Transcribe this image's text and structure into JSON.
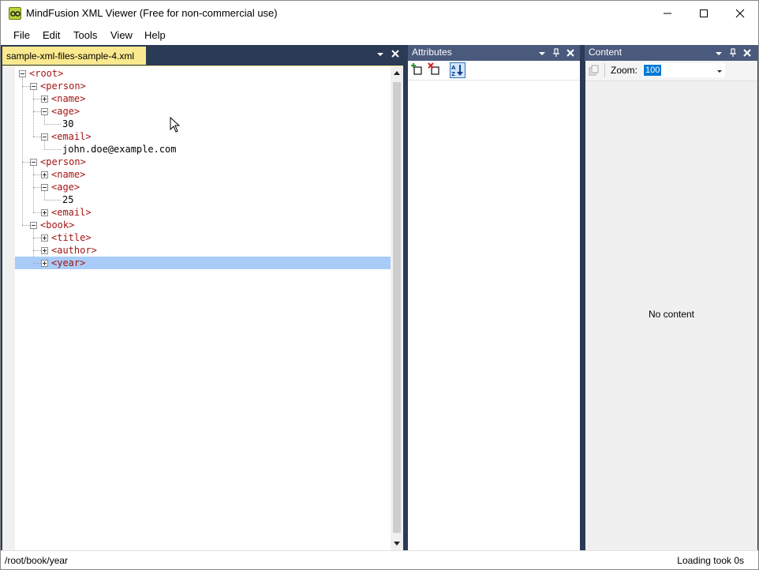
{
  "window": {
    "title": "MindFusion XML Viewer (Free for non-commercial use)"
  },
  "menu": [
    "File",
    "Edit",
    "Tools",
    "View",
    "Help"
  ],
  "document": {
    "tab_label": "sample-xml-files-sample-4.xml",
    "tree": [
      {
        "level": 0,
        "text": "<root>",
        "kind": "element",
        "expander": "minus"
      },
      {
        "level": 1,
        "text": "<person>",
        "kind": "element",
        "expander": "minus"
      },
      {
        "level": 2,
        "text": "<name>",
        "kind": "element",
        "expander": "plus"
      },
      {
        "level": 2,
        "text": "<age>",
        "kind": "element",
        "expander": "minus"
      },
      {
        "level": 3,
        "text": "30",
        "kind": "text",
        "expander": "none"
      },
      {
        "level": 2,
        "text": "<email>",
        "kind": "element",
        "expander": "minus"
      },
      {
        "level": 3,
        "text": "john.doe@example.com",
        "kind": "text",
        "expander": "none"
      },
      {
        "level": 1,
        "text": "<person>",
        "kind": "element",
        "expander": "minus"
      },
      {
        "level": 2,
        "text": "<name>",
        "kind": "element",
        "expander": "plus"
      },
      {
        "level": 2,
        "text": "<age>",
        "kind": "element",
        "expander": "minus"
      },
      {
        "level": 3,
        "text": "25",
        "kind": "text",
        "expander": "none"
      },
      {
        "level": 2,
        "text": "<email>",
        "kind": "element",
        "expander": "plus"
      },
      {
        "level": 1,
        "text": "<book>",
        "kind": "element",
        "expander": "minus"
      },
      {
        "level": 2,
        "text": "<title>",
        "kind": "element",
        "expander": "plus"
      },
      {
        "level": 2,
        "text": "<author>",
        "kind": "element",
        "expander": "plus"
      },
      {
        "level": 2,
        "text": "<year>",
        "kind": "element",
        "expander": "plus",
        "selected": true
      }
    ]
  },
  "attributes_pane": {
    "title": "Attributes",
    "toolbar": [
      {
        "icon": "add-attribute-icon"
      },
      {
        "icon": "remove-attribute-icon"
      },
      {
        "icon": "sort-az-icon",
        "active": true
      }
    ]
  },
  "content_pane": {
    "title": "Content",
    "zoom_label": "Zoom:",
    "zoom_value": "100",
    "empty_text": "No content"
  },
  "status": {
    "path": "/root/book/year",
    "message": "Loading took 0s"
  },
  "colors": {
    "frame": "#2b3a55",
    "pane_header": "#4a5a7c",
    "active_tab": "#fbe98f",
    "selection": "#a9cbf7",
    "xml_tag": "#a31515"
  }
}
